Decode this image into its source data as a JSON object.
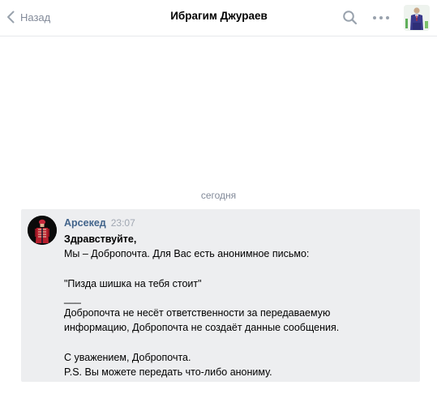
{
  "header": {
    "back_label": "Назад",
    "title": "Ибрагим Джураев",
    "search_icon": "search-icon",
    "more_icon": "more-dots-icon"
  },
  "chat": {
    "date_divider": "сегодня",
    "message": {
      "author": "Арсекед",
      "time": "23:07",
      "lines": [
        "Здравствуйте,",
        "Мы – Добропочта. Для Вас есть анонимное письмо:",
        "",
        "\"Пизда шишка на тебя стоит\"",
        "___",
        "Добропочта не несёт ответственности за передаваемую",
        "информацию, Добропочта не создаёт данные сообщения.",
        "",
        "С уважением, Добропочта.",
        "P.S. Вы можете передать что-либо анониму."
      ]
    }
  },
  "colors": {
    "accent_link": "#42648b",
    "muted_text": "#828a99",
    "message_bg": "#edeef0",
    "icon_gray": "#99a2ad"
  }
}
